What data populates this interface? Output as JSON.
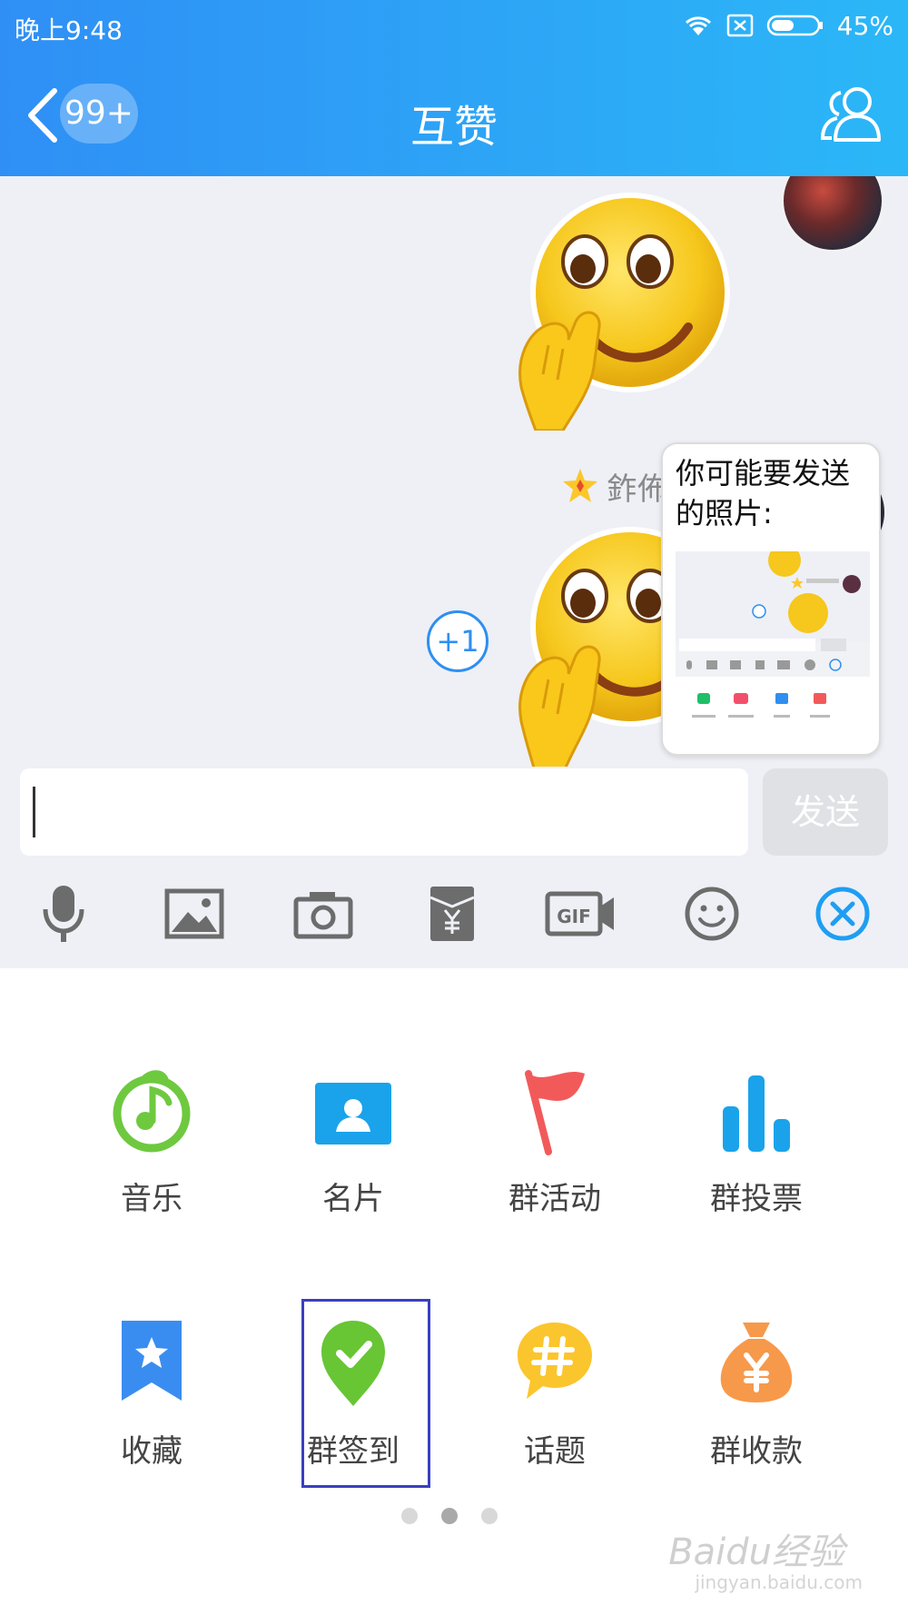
{
  "colors": {
    "header_start": "#2f8ff5",
    "header_end": "#2bb7f7",
    "chat_bg": "#eef0f6",
    "accent_blue": "#2e8ff0",
    "music_green": "#6ec93f",
    "card_blue": "#1aa3ea",
    "flag_red": "#f25a5a",
    "vote_blue": "#1aa3ea",
    "fav_blue": "#3a8df0",
    "checkin_green": "#68c534",
    "topic_yellow": "#fbc52d",
    "collect_orange": "#f7994a"
  },
  "status_bar": {
    "time": "晚上9:48",
    "battery": "45%",
    "icons": [
      "wifi-icon",
      "no-sim-icon",
      "battery-icon"
    ]
  },
  "header": {
    "back_icon": "chevron-left-icon",
    "unread_badge": "99+",
    "title": "互赞",
    "members_icon": "group-members-icon"
  },
  "chat": {
    "sender_name": "鈼佈",
    "plus_one": "+1",
    "emoji": "facepalm-emoji"
  },
  "suggestion": {
    "text": "你可能要发送的照片:"
  },
  "input": {
    "value": "",
    "send_label": "发送"
  },
  "toolbar": {
    "icons": [
      "microphone-icon",
      "image-icon",
      "camera-icon",
      "red-packet-icon",
      "gif-icon",
      "emoji-icon",
      "close-icon"
    ]
  },
  "features": {
    "items": [
      {
        "label": "音乐",
        "icon": "music-icon"
      },
      {
        "label": "名片",
        "icon": "contact-card-icon"
      },
      {
        "label": "群活动",
        "icon": "flag-icon"
      },
      {
        "label": "群投票",
        "icon": "bar-chart-icon"
      },
      {
        "label": "收藏",
        "icon": "bookmark-icon"
      },
      {
        "label": "群签到",
        "icon": "check-in-icon"
      },
      {
        "label": "话题",
        "icon": "hashtag-icon"
      },
      {
        "label": "群收款",
        "icon": "money-bag-icon"
      }
    ]
  },
  "pager": {
    "pages": 3,
    "current": 2
  },
  "watermark": {
    "text": "Baidu经验",
    "sub": "jingyan.baidu.com"
  }
}
